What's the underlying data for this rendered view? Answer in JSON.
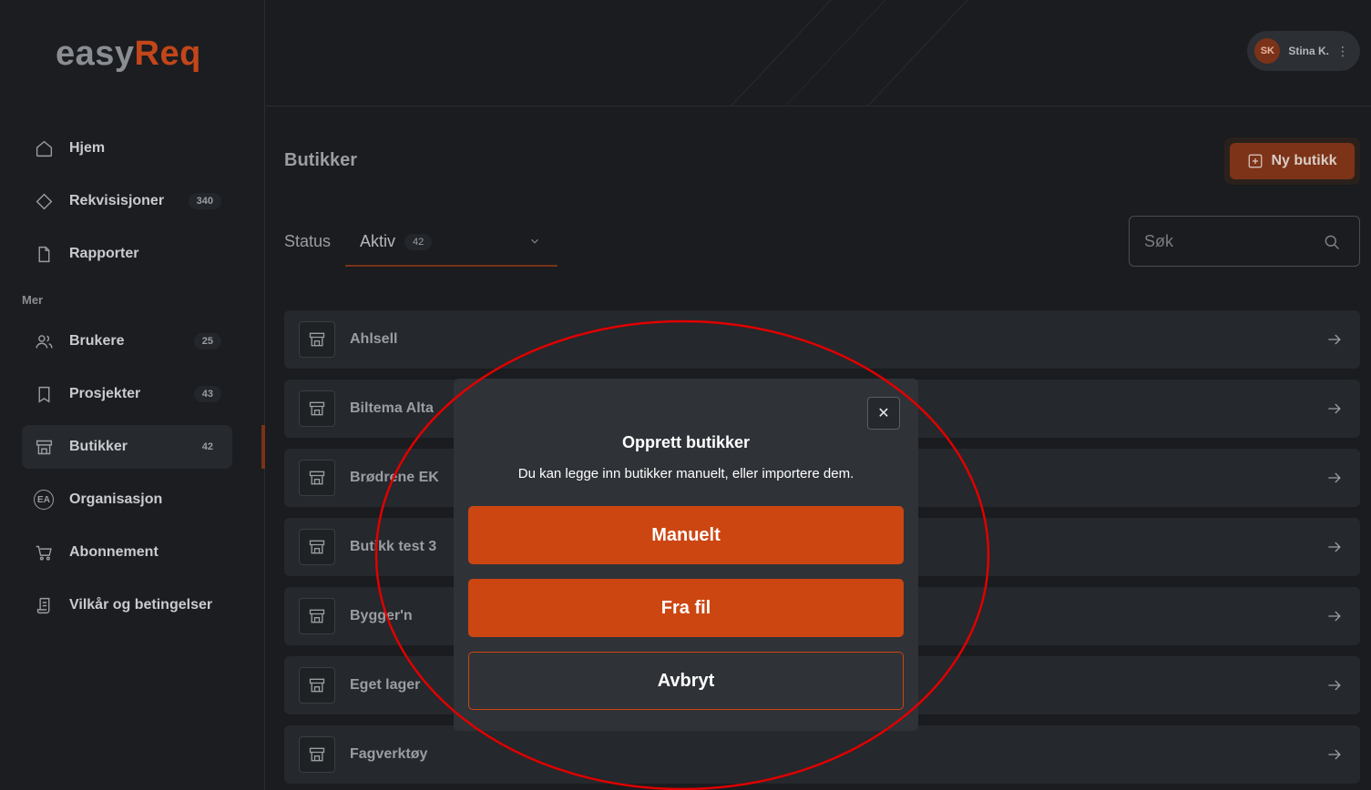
{
  "app": {
    "logo_part1": "easy",
    "logo_part2": "Req"
  },
  "user": {
    "initials": "SK",
    "name": "Stina K."
  },
  "sidebar": {
    "items": [
      {
        "label": "Hjem",
        "icon": "home-icon"
      },
      {
        "label": "Rekvisisjoner",
        "icon": "diamond-icon",
        "badge": "340"
      },
      {
        "label": "Rapporter",
        "icon": "document-icon"
      }
    ],
    "section_label": "Mer",
    "more_items": [
      {
        "label": "Brukere",
        "icon": "users-icon",
        "badge": "25"
      },
      {
        "label": "Prosjekter",
        "icon": "bookmark-icon",
        "badge": "43"
      },
      {
        "label": "Butikker",
        "icon": "store-icon",
        "badge": "42",
        "active": true
      },
      {
        "label": "Organisasjon",
        "icon": "organization-icon",
        "icon_text": "EA"
      },
      {
        "label": "Abonnement",
        "icon": "cart-icon"
      },
      {
        "label": "Vilkår og betingelser",
        "icon": "scroll-icon"
      }
    ]
  },
  "page": {
    "title": "Butikker",
    "new_button_label": "Ny butikk"
  },
  "filters": {
    "status_label": "Status",
    "status_value": "Aktiv",
    "status_count": "42",
    "search_placeholder": "Søk"
  },
  "stores": [
    "Ahlsell",
    "Biltema Alta",
    "Brødrene EK",
    "Butikk test 3",
    "Bygger'n",
    "Eget lager",
    "Fagverktøy"
  ],
  "modal": {
    "title": "Opprett butikker",
    "description": "Du kan legge inn butikker manuelt, eller importere dem.",
    "manual_label": "Manuelt",
    "file_label": "Fra fil",
    "cancel_label": "Avbryt",
    "close_icon": "close-icon"
  },
  "colors": {
    "accent": "#cc4612",
    "annotation": "#e00000"
  }
}
